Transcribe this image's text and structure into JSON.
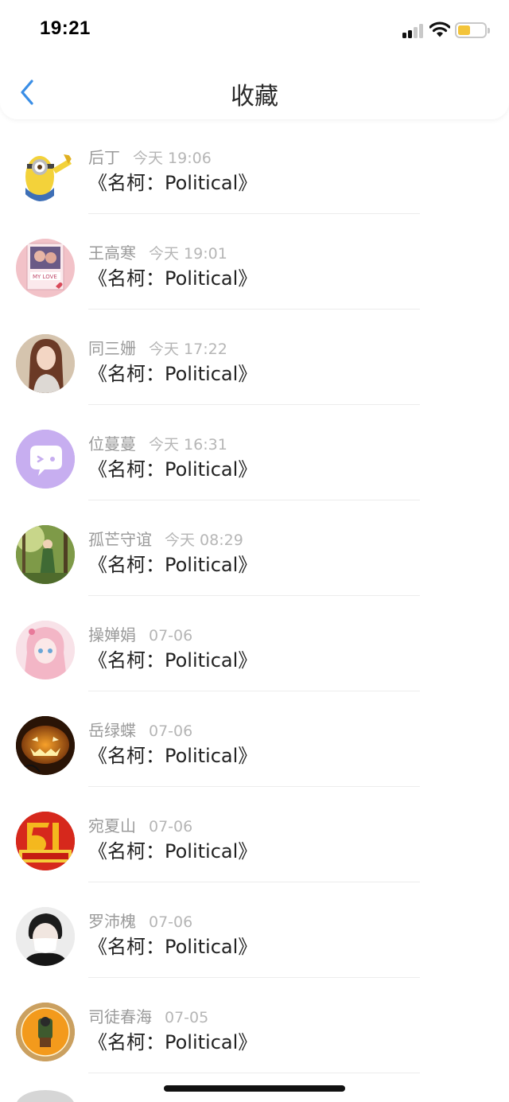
{
  "status_bar": {
    "time": "19:21"
  },
  "nav": {
    "title": "收藏"
  },
  "items": [
    {
      "name": "后丁",
      "date": "今天 19:06",
      "message": "《名柯：Political》"
    },
    {
      "name": "王高寒",
      "date": "今天 19:01",
      "message": "《名柯：Political》"
    },
    {
      "name": "同三姗",
      "date": "今天 17:22",
      "message": "《名柯：Political》"
    },
    {
      "name": "位蔓蔓",
      "date": "今天 16:31",
      "message": "《名柯：Political》"
    },
    {
      "name": "孤芒守谊",
      "date": "今天 08:29",
      "message": "《名柯：Political》"
    },
    {
      "name": "操婵娟",
      "date": "07-06",
      "message": "《名柯：Political》"
    },
    {
      "name": "岳绿蝶",
      "date": "07-06",
      "message": "《名柯：Political》"
    },
    {
      "name": "宛夏山",
      "date": "07-06",
      "message": "《名柯：Political》"
    },
    {
      "name": "罗沛槐",
      "date": "07-06",
      "message": "《名柯：Political》"
    },
    {
      "name": "司徒春海",
      "date": "07-05",
      "message": "《名柯：Political》"
    }
  ],
  "colors": {
    "accent": "#3a8ee6",
    "battery_fill": "#f3c43a",
    "name_text": "#9a9a9a",
    "date_text": "#b6b6b6"
  }
}
